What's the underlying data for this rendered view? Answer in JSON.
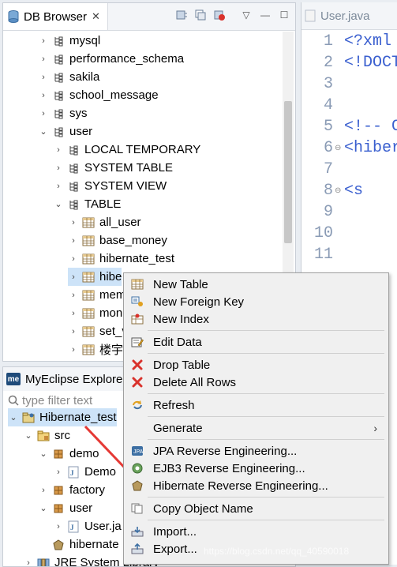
{
  "db_browser": {
    "title": "DB Browser",
    "tree": [
      {
        "label": "mysql",
        "indent": 0,
        "icon": "schema-icon",
        "chev": "›"
      },
      {
        "label": "performance_schema",
        "indent": 0,
        "icon": "schema-icon",
        "chev": "›"
      },
      {
        "label": "sakila",
        "indent": 0,
        "icon": "schema-icon",
        "chev": "›"
      },
      {
        "label": "school_message",
        "indent": 0,
        "icon": "schema-icon",
        "chev": "›"
      },
      {
        "label": "sys",
        "indent": 0,
        "icon": "schema-icon",
        "chev": "›"
      },
      {
        "label": "user",
        "indent": 0,
        "icon": "schema-icon",
        "chev": "⌄"
      },
      {
        "label": "LOCAL TEMPORARY",
        "indent": 1,
        "icon": "schema-icon",
        "chev": "›"
      },
      {
        "label": "SYSTEM TABLE",
        "indent": 1,
        "icon": "schema-icon",
        "chev": "›"
      },
      {
        "label": "SYSTEM VIEW",
        "indent": 1,
        "icon": "schema-icon",
        "chev": "›"
      },
      {
        "label": "TABLE",
        "indent": 1,
        "icon": "schema-icon",
        "chev": "⌄"
      },
      {
        "label": "all_user",
        "indent": 2,
        "icon": "table-icon",
        "chev": "›"
      },
      {
        "label": "base_money",
        "indent": 2,
        "icon": "table-icon",
        "chev": "›"
      },
      {
        "label": "hibernate_test",
        "indent": 2,
        "icon": "table-icon",
        "chev": "›"
      },
      {
        "label": "hibe",
        "indent": 2,
        "icon": "table-icon",
        "chev": "›",
        "selected": true
      },
      {
        "label": "mem",
        "indent": 2,
        "icon": "table-icon",
        "chev": "›"
      },
      {
        "label": "mon",
        "indent": 2,
        "icon": "table-icon",
        "chev": "›"
      },
      {
        "label": "set_v",
        "indent": 2,
        "icon": "table-icon",
        "chev": "›"
      },
      {
        "label": "楼宇",
        "indent": 2,
        "icon": "table-icon",
        "chev": "›"
      }
    ]
  },
  "editor": {
    "tab": "User.java",
    "line_numbers": [
      "1",
      "2",
      "3",
      "4",
      "5",
      "6",
      "7",
      "8",
      "9",
      "10",
      "11"
    ],
    "code_lines": [
      "<?xml",
      "<!DOCT",
      "",
      "",
      "<!-- C",
      "<hiber",
      "",
      "  <s",
      "",
      "",
      ""
    ]
  },
  "explorer": {
    "title": "MyEclipse Explore",
    "filter_placeholder": "type filter text",
    "tree": [
      {
        "label": "Hibernate_test",
        "indent": 0,
        "chev": "⌄",
        "icon": "project-icon",
        "selected": true
      },
      {
        "label": "src",
        "indent": 1,
        "chev": "⌄",
        "icon": "source-folder-icon"
      },
      {
        "label": "demo",
        "indent": 2,
        "chev": "⌄",
        "icon": "package-icon"
      },
      {
        "label": "Demo",
        "indent": 3,
        "chev": "›",
        "icon": "java-file-icon"
      },
      {
        "label": "factory",
        "indent": 2,
        "chev": "›",
        "icon": "package-icon"
      },
      {
        "label": "user",
        "indent": 2,
        "chev": "⌄",
        "icon": "package-icon"
      },
      {
        "label": "User.ja",
        "indent": 3,
        "chev": "›",
        "icon": "java-file-icon"
      },
      {
        "label": "hibernate",
        "indent": 2,
        "chev": "",
        "icon": "hibernate-icon"
      },
      {
        "label": "JRE System Library",
        "indent": 1,
        "chev": "›",
        "icon": "library-icon"
      }
    ]
  },
  "context_menu": {
    "items": [
      {
        "label": "New Table",
        "icon": "table-icon"
      },
      {
        "label": "New Foreign Key",
        "icon": "foreign-key-icon"
      },
      {
        "label": "New Index",
        "icon": "index-icon"
      },
      {
        "sep": true
      },
      {
        "label": "Edit Data",
        "icon": "edit-data-icon"
      },
      {
        "sep": true
      },
      {
        "label": "Drop Table",
        "icon": "delete-icon"
      },
      {
        "label": "Delete All Rows",
        "icon": "delete-icon"
      },
      {
        "sep": true
      },
      {
        "label": "Refresh",
        "icon": "refresh-icon"
      },
      {
        "sep": true
      },
      {
        "label": "Generate",
        "icon": "",
        "submenu": true
      },
      {
        "sep": true
      },
      {
        "label": "JPA Reverse Engineering...",
        "icon": "jpa-icon"
      },
      {
        "label": "EJB3 Reverse Engineering...",
        "icon": "ejb3-icon"
      },
      {
        "label": "Hibernate Reverse Engineering...",
        "icon": "hibernate-icon"
      },
      {
        "sep": true
      },
      {
        "label": "Copy Object Name",
        "icon": "copy-icon"
      },
      {
        "sep": true
      },
      {
        "label": "Import...",
        "icon": "import-icon"
      },
      {
        "label": "Export...",
        "icon": "export-icon"
      }
    ]
  },
  "watermark": "https://blog.csdn.net/qq_40590018",
  "colors": {
    "selection": "#cde3f8",
    "arrow": "#e53935",
    "code_blue": "#3a5fcf"
  }
}
